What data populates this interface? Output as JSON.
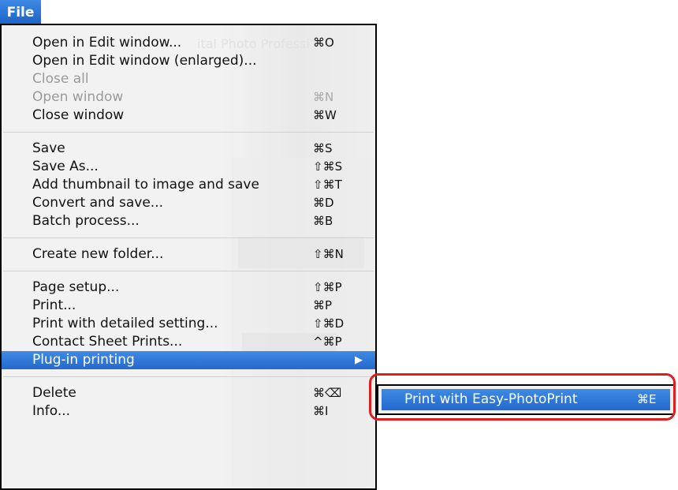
{
  "menubar": {
    "title": "File"
  },
  "menu": {
    "ghost_text": "ital Photo Professi",
    "groups": [
      [
        {
          "label": "Open in Edit window...",
          "shortcut": "⌘O"
        },
        {
          "label": "Open in Edit window (enlarged)...",
          "shortcut": ""
        },
        {
          "label": "Close all",
          "shortcut": "",
          "disabled": true
        },
        {
          "label": "Open window",
          "shortcut": "⌘N",
          "disabled": true
        },
        {
          "label": "Close window",
          "shortcut": "⌘W"
        }
      ],
      [
        {
          "label": "Save",
          "shortcut": "⌘S"
        },
        {
          "label": "Save As...",
          "shortcut": "⇧⌘S"
        },
        {
          "label": "Add thumbnail to image and save",
          "shortcut": "⇧⌘T"
        },
        {
          "label": "Convert and save...",
          "shortcut": "⌘D"
        },
        {
          "label": "Batch process...",
          "shortcut": "⌘B"
        }
      ],
      [
        {
          "label": "Create new folder...",
          "shortcut": "⇧⌘N"
        }
      ],
      [
        {
          "label": "Page setup...",
          "shortcut": "⇧⌘P"
        },
        {
          "label": "Print...",
          "shortcut": "⌘P"
        },
        {
          "label": "Print with detailed setting...",
          "shortcut": "⇧⌘D"
        },
        {
          "label": "Contact Sheet Prints...",
          "shortcut": "^⌘P"
        },
        {
          "label": "Plug-in printing",
          "shortcut": "",
          "highlighted": true,
          "submenu_arrow": "▶"
        }
      ],
      [
        {
          "label": "Delete",
          "shortcut": "⌘⌫"
        },
        {
          "label": "Info...",
          "shortcut": "⌘I"
        }
      ]
    ]
  },
  "submenu": {
    "items": [
      {
        "label": "Print with Easy-PhotoPrint",
        "shortcut": "⌘E",
        "highlighted": true
      }
    ]
  },
  "callout": {
    "color": "#e01e1e"
  },
  "colors": {
    "highlight": "#2c73d8",
    "menu_bg": "#f2f2f2"
  }
}
